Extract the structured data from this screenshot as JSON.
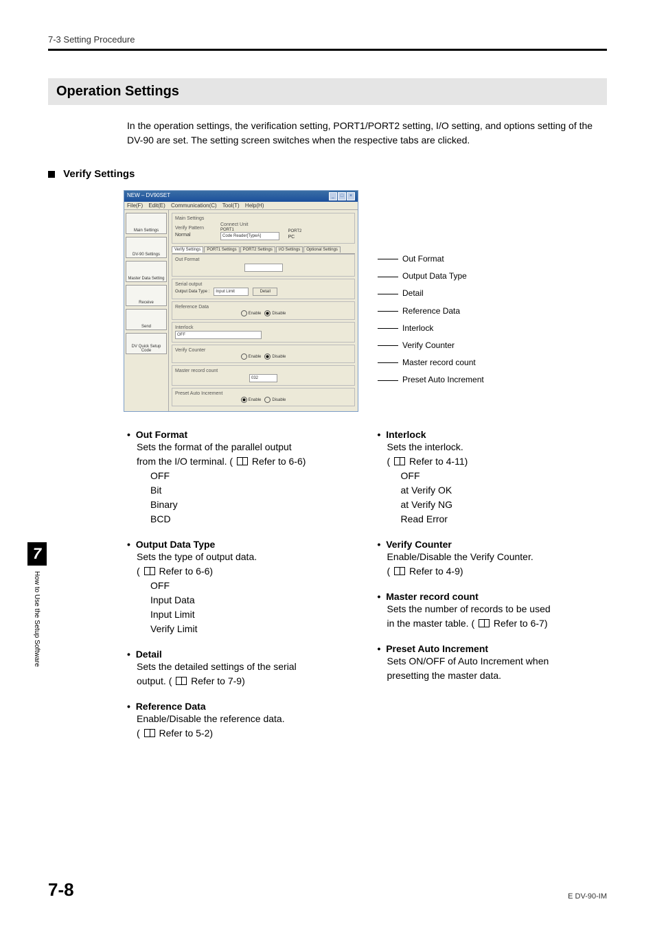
{
  "header": {
    "breadcrumb": "7-3  Setting Procedure"
  },
  "section": {
    "title": "Operation Settings",
    "intro": "In the operation settings, the verification setting, PORT1/PORT2 setting, I/O setting, and options setting of the DV-90 are set. The setting screen switches when the respective tabs are clicked."
  },
  "sub": {
    "title": "Verify Settings"
  },
  "app": {
    "title": "NEW – DV90SET",
    "menu": {
      "file": "File(F)",
      "edit": "Edit(E)",
      "comm": "Communication(C)",
      "tool": "Tool(T)",
      "help": "Help(H)"
    },
    "sidebar": {
      "main_settings": "Main Settings",
      "dv90_settings": "DV-90 Settings",
      "master_data": "Master Data Setting",
      "receive": "Receive",
      "send": "Send",
      "quick": "DV Quick Setup Code"
    },
    "main_settings_panel": {
      "label": "Main Settings",
      "verify_pattern_label": "Verify Pattern",
      "verify_pattern_value": "Normal",
      "connect_unit_label": "Connect Unit",
      "port1": "PORT1",
      "port1_value": "Code Reader[TypeA]",
      "port2": "PORT2",
      "port2_value": "PC"
    },
    "tabs": {
      "verify": "Verify Settings",
      "p1": "PORT1 Settings",
      "p2": "PORT2 Settings",
      "io": "I/O Settings",
      "opt": "Optional Settings"
    },
    "fields": {
      "out_format": "Out Format",
      "serial_output": "Serial output",
      "output_data_type": "Output Data Type :",
      "output_data_value": "Input Limit",
      "detail_btn": "Detail",
      "reference_data": "Reference Data",
      "enable": "Enable",
      "disable": "Disable",
      "interlock": "Interlock",
      "interlock_value": "OFF",
      "verify_counter": "Verify Counter",
      "master_record": "Master record count",
      "master_record_value": "032",
      "preset_auto": "Preset Auto Increment"
    }
  },
  "callouts": {
    "out_format": "Out Format",
    "output_data_type": "Output Data Type",
    "detail": "Detail",
    "reference_data": "Reference Data",
    "interlock": "Interlock",
    "verify_counter": "Verify Counter",
    "master_record": "Master record count",
    "preset_auto": "Preset Auto Increment"
  },
  "left": {
    "out_format": {
      "title": "Out Format",
      "desc1": "Sets the format of the parallel output",
      "desc2a": "from the I/O terminal. ( ",
      "desc2b": " Refer to 6-6)",
      "opts": {
        "a": "OFF",
        "b": "Bit",
        "c": "Binary",
        "d": "BCD"
      }
    },
    "output_data_type": {
      "title": "Output Data Type",
      "desc": "Sets the type of output data.",
      "ref_a": "( ",
      "ref_b": " Refer to 6-6)",
      "opts": {
        "a": "OFF",
        "b": "Input Data",
        "c": "Input Limit",
        "d": "Verify Limit"
      }
    },
    "detail": {
      "title": "Detail",
      "desc": "Sets the detailed settings of the serial",
      "desc2a": "output. ( ",
      "desc2b": " Refer to 7-9)"
    },
    "reference_data": {
      "title": "Reference Data",
      "desc": "Enable/Disable the reference data.",
      "ref_a": "( ",
      "ref_b": " Refer to 5-2)"
    }
  },
  "right": {
    "interlock": {
      "title": "Interlock",
      "desc": "Sets the interlock.",
      "ref_a": "( ",
      "ref_b": " Refer to 4-11)",
      "opts": {
        "a": "OFF",
        "b": "at Verify OK",
        "c": "at Verify NG",
        "d": "Read Error"
      }
    },
    "verify_counter": {
      "title": "Verify Counter",
      "desc": "Enable/Disable the Verify Counter.",
      "ref_a": "( ",
      "ref_b": " Refer to 4-9)"
    },
    "master_record": {
      "title": "Master record count",
      "desc": "Sets the number of records to be used",
      "desc2a": "in the master table. ( ",
      "desc2b": " Refer to 6-7)"
    },
    "preset_auto": {
      "title": "Preset Auto Increment",
      "desc1": "Sets ON/OFF of Auto Increment when",
      "desc2": "presetting the master data."
    }
  },
  "sidetab": {
    "num": "7",
    "label": "How to Use the Setup Software"
  },
  "footer": {
    "page": "7-8",
    "doc": "E DV-90-IM"
  }
}
